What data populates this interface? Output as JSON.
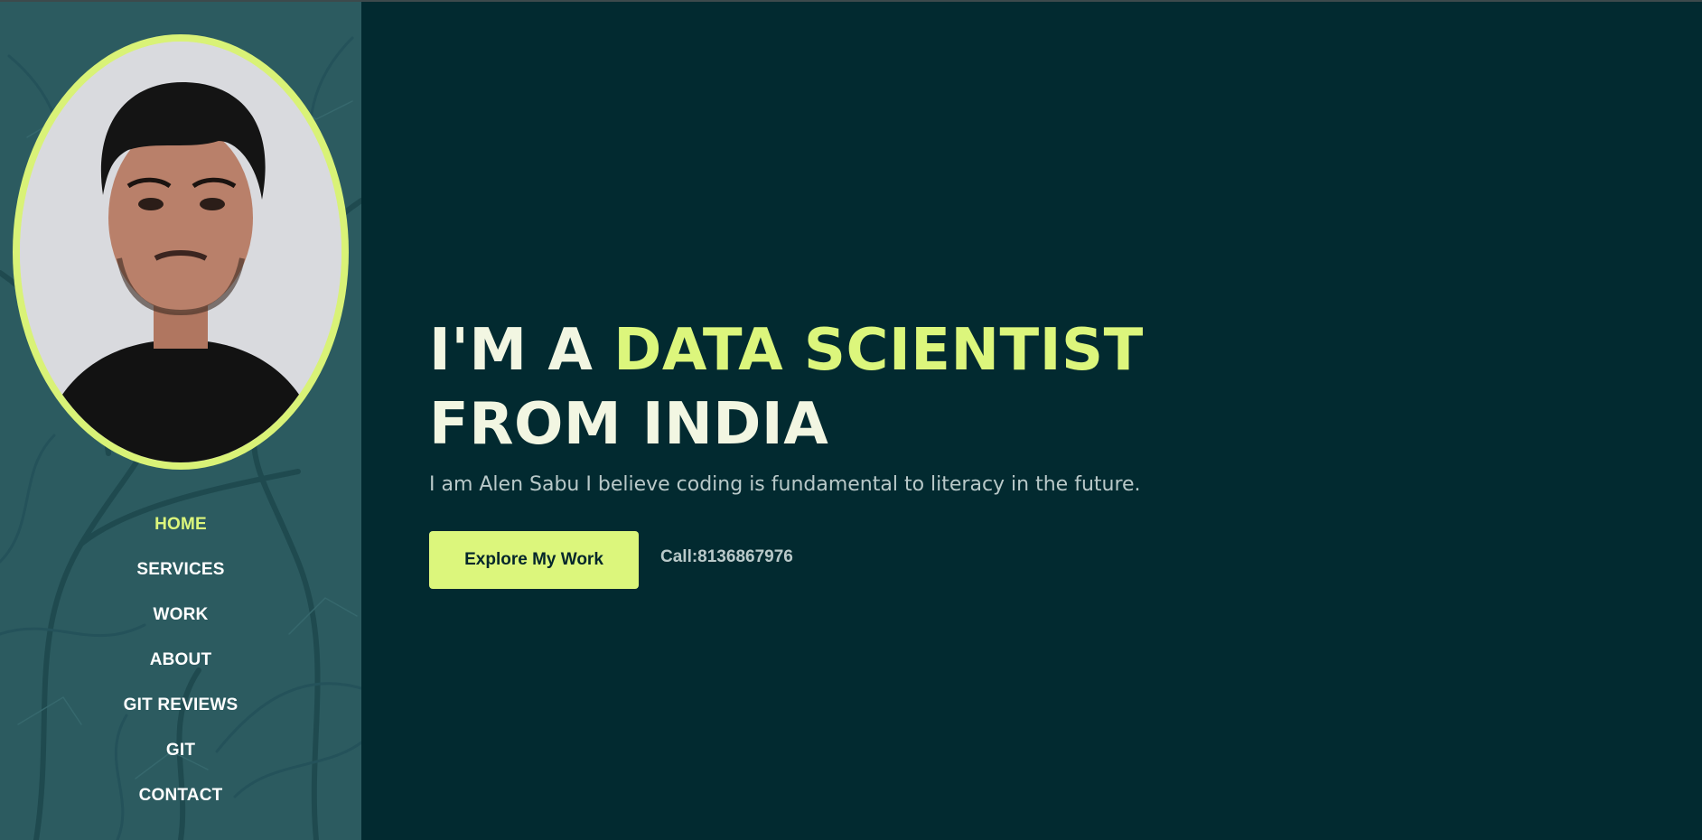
{
  "sidebar": {
    "nav": [
      {
        "label": "HOME",
        "active": true
      },
      {
        "label": "SERVICES",
        "active": false
      },
      {
        "label": "WORK",
        "active": false
      },
      {
        "label": "ABOUT",
        "active": false
      },
      {
        "label": "GIT REVIEWS",
        "active": false
      },
      {
        "label": "GIT",
        "active": false
      },
      {
        "label": "CONTACT",
        "active": false
      }
    ]
  },
  "hero": {
    "headline_pre": "I'M A ",
    "headline_accent": "DATA SCIENTIST",
    "headline_post": " FROM INDIA",
    "subtitle": "I am Alen Sabu I believe coding is fundamental to literacy in the future.",
    "cta_label": "Explore My Work",
    "call_text": "Call:8136867976"
  },
  "colors": {
    "background": "#022a30",
    "sidebar": "#2c5b60",
    "accent": "#dcf67c",
    "headline": "#f2f6e2",
    "muted_text": "#b9c9c9"
  }
}
